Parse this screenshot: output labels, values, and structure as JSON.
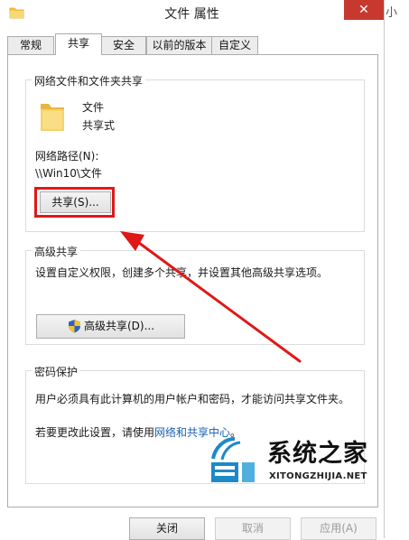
{
  "window": {
    "title": "文件 属性",
    "close_glyph": "✕",
    "outside_text": "小"
  },
  "tabs": [
    {
      "label": "常规"
    },
    {
      "label": "共享"
    },
    {
      "label": "安全"
    },
    {
      "label": "以前的版本"
    },
    {
      "label": "自定义"
    }
  ],
  "network_sharing": {
    "group_title": "网络文件和文件夹共享",
    "folder_name": "文件",
    "share_status": "共享式",
    "path_label": "网络路径(N):",
    "path_value": "\\\\Win10\\文件",
    "share_button": "共享(S)..."
  },
  "advanced_sharing": {
    "group_title": "高级共享",
    "description": "设置自定义权限，创建多个共享，并设置其他高级共享选项。",
    "button": "高级共享(D)..."
  },
  "password_protection": {
    "group_title": "密码保护",
    "description": "用户必须具有此计算机的用户帐户和密码，才能访问共享文件夹。",
    "change_prefix": "若要更改此设置，请使用",
    "change_link": "网络和共享中心",
    "change_suffix": "。"
  },
  "footer": {
    "close": "关闭",
    "cancel": "取消",
    "apply": "应用(A)"
  },
  "watermark": {
    "cn": "系统之家",
    "en": "XITONGZHIJIA.NET"
  },
  "colors": {
    "accent_red": "#e01818",
    "close_red": "#c7382f",
    "link_blue": "#1a5fb4",
    "folder_yellow": "#f3c64b",
    "watermark_blue": "#1e88c8"
  }
}
